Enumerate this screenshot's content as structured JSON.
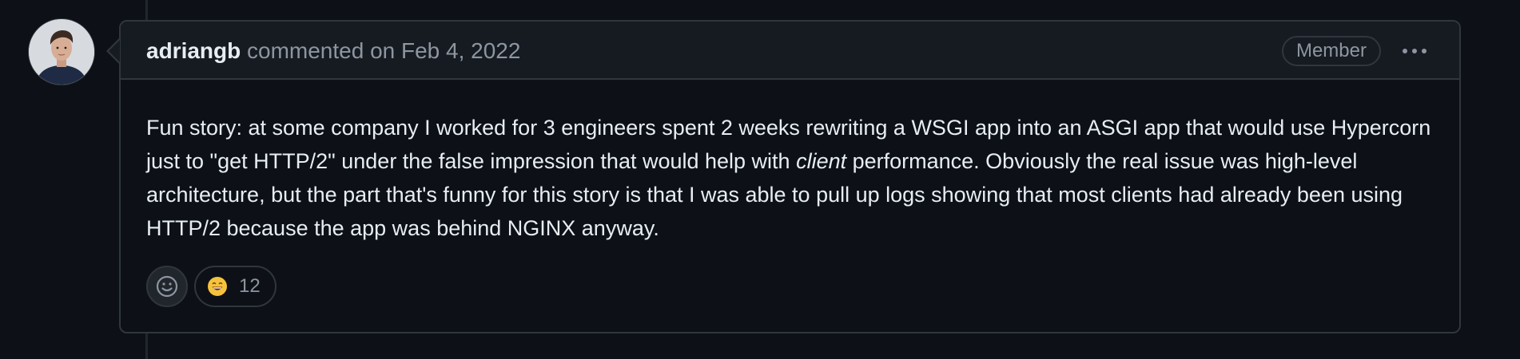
{
  "comment": {
    "author": "adriangb",
    "meta": " commented on Feb 4, 2022",
    "badge": "Member",
    "body": {
      "part1": "Fun story: at some company I worked for 3 engineers spent 2 weeks rewriting a WSGI app into an ASGI app that would use Hypercorn just to \"get HTTP/2\" under the false impression that would help with ",
      "emphasis": "client",
      "part2": " performance. Obviously the real issue was high-level architecture, but the part that's funny for this story is that I was able to pull up logs showing that most clients had already been using HTTP/2 because the app was behind NGINX anyway."
    },
    "reactions": [
      {
        "emoji": "smile",
        "count": "12"
      }
    ]
  },
  "icons": {
    "options": "kebab-horizontal-icon",
    "add_reaction": "smiley-icon",
    "reaction": "grinning-face-emoji"
  },
  "colors": {
    "background": "#0d1117",
    "header": "#161b22",
    "border": "#30363d",
    "muted_text": "#8d96a0",
    "text": "#e6edf3"
  }
}
